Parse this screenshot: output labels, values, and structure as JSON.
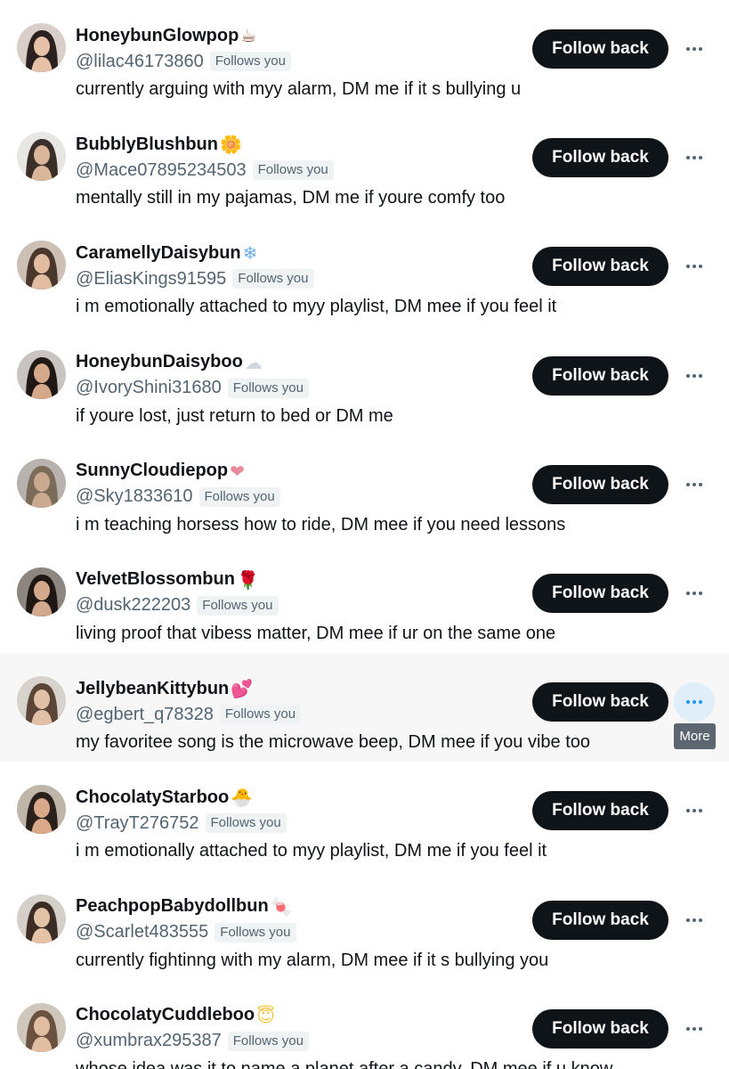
{
  "accounts": [
    {
      "display_name": "HoneybunGlowpop",
      "emoji": "☕",
      "handle": "@lilac46173860",
      "follows_you": "Follows you",
      "bio": "currently arguing with myy alarm, DM me if it s bullying u",
      "follow_label": "Follow back"
    },
    {
      "display_name": "BubblyBlushbun",
      "emoji": "🌼",
      "handle": "@Mace07895234503",
      "follows_you": "Follows you",
      "bio": "mentally still in my pajamas, DM me if youre comfy too",
      "follow_label": "Follow back"
    },
    {
      "display_name": "CaramellyDaisybun",
      "emoji": "❄",
      "handle": "@EliasKings91595",
      "follows_you": "Follows you",
      "bio": "i m emotionally attached to myy playlist, DM mee if you feel it",
      "follow_label": "Follow back"
    },
    {
      "display_name": "HoneybunDaisyboo",
      "emoji": "☁",
      "handle": "@IvoryShini31680",
      "follows_you": "Follows you",
      "bio": "if youre lost, just return to bed or DM me",
      "follow_label": "Follow back"
    },
    {
      "display_name": "SunnyCloudiepop",
      "emoji": "❤",
      "handle": "@Sky1833610",
      "follows_you": "Follows you",
      "bio": "i m teaching horsess how to ride, DM mee if you need lessons",
      "follow_label": "Follow back"
    },
    {
      "display_name": "VelvetBlossombun",
      "emoji": "🌹",
      "handle": "@dusk222203",
      "follows_you": "Follows you",
      "bio": "living proof that vibess matter, DM mee if ur on the same one",
      "follow_label": "Follow back"
    },
    {
      "display_name": "JellybeanKittybun",
      "emoji": "💕",
      "handle": "@egbert_q78328",
      "follows_you": "Follows you",
      "bio": "my favoritee song is the microwave beep, DM mee if you vibe too",
      "follow_label": "Follow back"
    },
    {
      "display_name": "ChocolatyStarboo",
      "emoji": "🐣",
      "handle": "@TrayT276752",
      "follows_you": "Follows you",
      "bio": "i m emotionally attached to myy playlist, DM me if you feel it",
      "follow_label": "Follow back"
    },
    {
      "display_name": "PeachpopBabydollbun",
      "emoji": "🍬",
      "handle": "@Scarlet483555",
      "follows_you": "Follows you",
      "bio": "currently fightinng with my alarm, DM mee if it s bullying you",
      "follow_label": "Follow back"
    },
    {
      "display_name": "ChocolatyCuddleboo",
      "emoji": "😇",
      "handle": "@xumbrax295387",
      "follows_you": "Follows you",
      "bio": "whose idea was it to name a planet after a candy, DM mee if u know",
      "follow_label": "Follow back"
    }
  ],
  "hovered_index": 6,
  "tooltip": "More",
  "colors": {
    "button_bg": "#0f1419",
    "secondary_text": "#536471",
    "hover_row_bg": "#f7f7f7",
    "hover_icon_bg": "#e0eefa",
    "tooltip_bg": "#5b6670",
    "emoji_colors": [
      "#8a5a3b",
      "#f2a81d",
      "#6aaee6",
      "#cfd8e0",
      "#e78a9a",
      "#b8202a",
      "#d83a56",
      "#f5c542",
      "#d8334a",
      "#f5c542"
    ],
    "avatar_palettes": [
      [
        "#d9cfc8",
        "#2a2120",
        "#e6c1a7"
      ],
      [
        "#e8e6e3",
        "#3a2e28",
        "#d9b59a"
      ],
      [
        "#cdbfb4",
        "#4a372c",
        "#e2bca0"
      ],
      [
        "#c9c4c2",
        "#201815",
        "#d6a88a"
      ],
      [
        "#b7b2ae",
        "#7a6a58",
        "#c9a98f"
      ],
      [
        "#8d8580",
        "#1f1714",
        "#d3a98e"
      ],
      [
        "#d8d2cc",
        "#5a4536",
        "#e0c0a6"
      ],
      [
        "#bfb5a8",
        "#2b211c",
        "#d9a98a"
      ],
      [
        "#d5cfc9",
        "#3b2d25",
        "#e5c3a7"
      ],
      [
        "#cfc6bc",
        "#6b5140",
        "#e1bea2"
      ]
    ]
  }
}
